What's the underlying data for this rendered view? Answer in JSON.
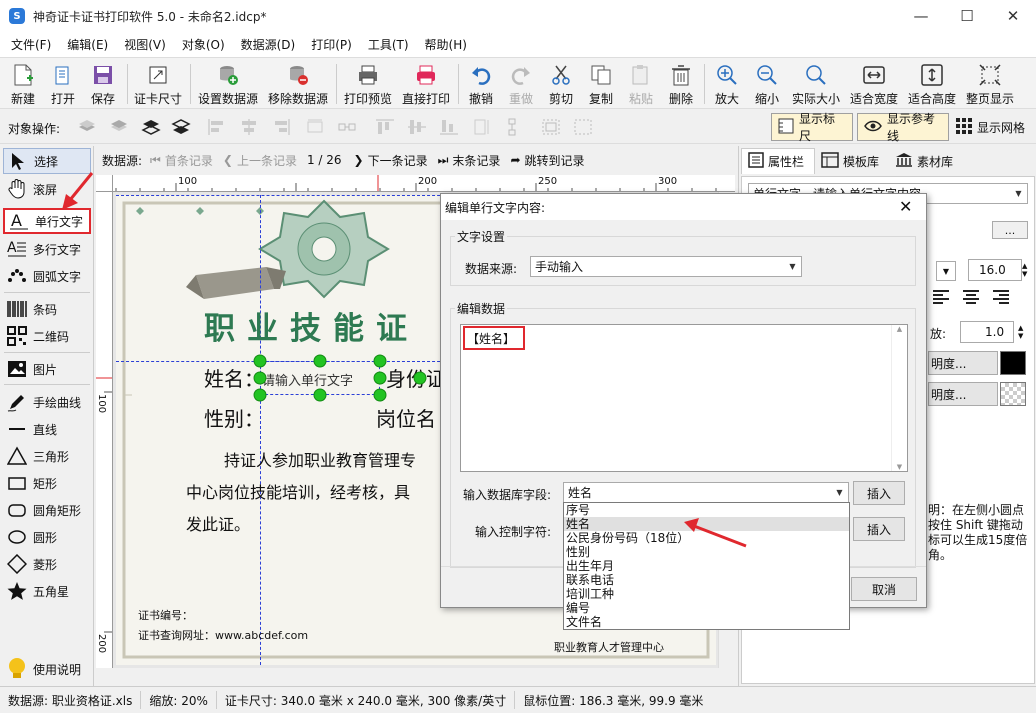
{
  "window": {
    "title": "神奇证卡证书打印软件 5.0 - 未命名2.idcp*",
    "app_icon_letter": "S"
  },
  "menu": [
    "文件(F)",
    "编辑(E)",
    "视图(V)",
    "对象(O)",
    "数据源(D)",
    "打印(P)",
    "工具(T)",
    "帮助(H)"
  ],
  "toolbar": {
    "new": "新建",
    "open": "打开",
    "save": "保存",
    "card_size": "证卡尺寸",
    "set_datasource": "设置数据源",
    "remove_datasource": "移除数据源",
    "print_preview": "打印预览",
    "direct_print": "直接打印",
    "undo": "撤销",
    "redo": "重做",
    "cut": "剪切",
    "copy": "复制",
    "paste": "粘贴",
    "delete": "删除",
    "zoom_in": "放大",
    "zoom_out": "缩小",
    "actual_size": "实际大小",
    "fit_width": "适合宽度",
    "fit_height": "适合高度",
    "full_page": "整页显示"
  },
  "objbar": {
    "label": "对象操作:",
    "show_ruler": "显示标尺",
    "show_guides": "显示参考线",
    "show_grid": "显示网格"
  },
  "tools": {
    "select": "选择",
    "scroll": "滚屏",
    "single_text": "单行文字",
    "multi_text": "多行文字",
    "arc_text": "圆弧文字",
    "barcode": "条码",
    "qrcode": "二维码",
    "image": "图片",
    "freehand": "手绘曲线",
    "line": "直线",
    "triangle": "三角形",
    "rect": "矩形",
    "round_rect": "圆角矩形",
    "circle": "圆形",
    "diamond": "菱形",
    "star": "五角星",
    "help": "使用说明"
  },
  "recnav": {
    "label": "数据源:",
    "first": "首条记录",
    "prev": "上一条记录",
    "position": "1 / 26",
    "next": "下一条记录",
    "last": "末条记录",
    "goto": "跳转到记录"
  },
  "ruler": {
    "top": [
      "100",
      "150",
      "200",
      "250",
      "300"
    ],
    "left": [
      "100",
      "150",
      "200"
    ]
  },
  "card": {
    "title": "职业技能证",
    "name_label": "姓名：",
    "placeholder_text": "请输入单行文字",
    "id_label": "身份证",
    "gender_label": "性别：",
    "post_label": "岗位名",
    "body1": "持证人参加职业教育管理专",
    "body2": "中心岗位技能培训，经考核，具",
    "body3": "发此证。",
    "cert_no": "证书编号：",
    "query_url": "证书查询网址：www.abcdef.com",
    "issuer": "职业教育人才管理中心"
  },
  "rightpanel": {
    "tabs": [
      "属性栏",
      "模板库",
      "素材库"
    ],
    "type_combo": "单行文字 - 请输入单行文字内容",
    "font_size": "16.0",
    "scale_label": "放:",
    "scale_value": "1.0",
    "transparency1": "明度...",
    "transparency2": "明度...",
    "color1": "#000000",
    "help_lines": [
      "明：在左侧小圆点",
      "按住 Shift 键拖动",
      "标可以生成15度倍",
      "角。"
    ]
  },
  "dialog": {
    "title": "编辑单行文字内容:",
    "group_text_settings": "文字设置",
    "datasource_label": "数据来源:",
    "datasource_value": "手动输入",
    "group_edit_data": "编辑数据",
    "edit_content": "【姓名】",
    "field_label": "输入数据库字段:",
    "field_value": "姓名",
    "field_options": [
      "序号",
      "姓名",
      "公民身份号码（18位）",
      "性别",
      "出生年月",
      "联系电话",
      "培训工种",
      "编号",
      "文件名"
    ],
    "field_selected_index": 1,
    "ctrl_label": "输入控制字符:",
    "insert1": "插入",
    "insert2": "插入",
    "cancel": "取消"
  },
  "status": {
    "datasource": "数据源: 职业资格证.xls",
    "zoom": "缩放: 20%",
    "card_size": "证卡尺寸: 340.0 毫米 x 240.0 毫米, 300 像素/英寸",
    "mouse_pos": "鼠标位置: 186.3 毫米, 99.9 毫米"
  },
  "colors": {
    "accent_red": "#e0282e",
    "title_green": "#2e7a52",
    "ribbon_gray": "#8a8a80"
  }
}
